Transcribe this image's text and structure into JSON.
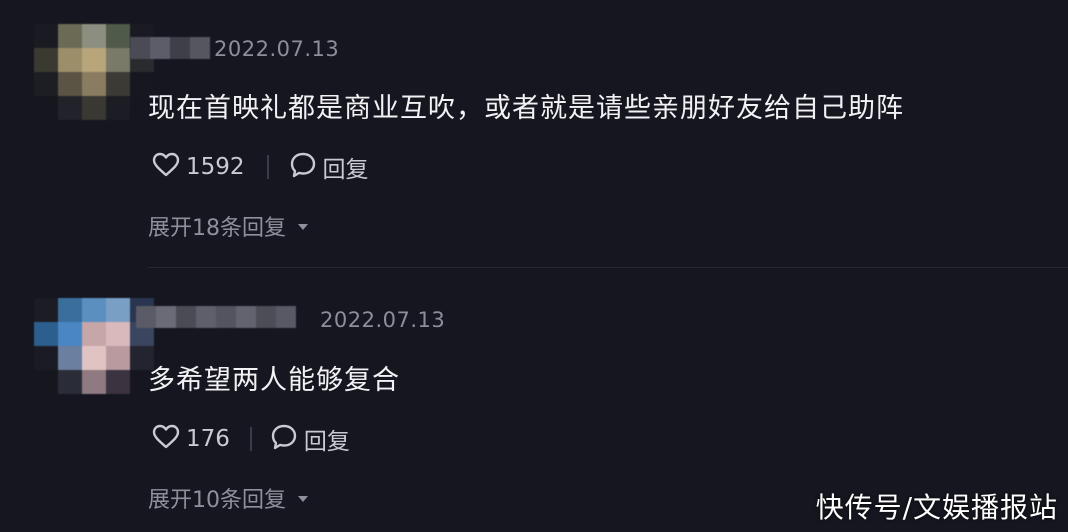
{
  "comments": [
    {
      "date": "2022.07.13",
      "text": "现在首映礼都是商业互吹，或者就是请些亲朋好友给自己助阵",
      "likes": "1592",
      "reply_label": "回复",
      "expand_label": "展开18条回复"
    },
    {
      "date": "2022.07.13",
      "text": "多希望两人能够复合",
      "likes": "176",
      "reply_label": "回复",
      "expand_label": "展开10条回复"
    }
  ],
  "watermark": "快传号/文娱播报站",
  "colors": {
    "background": "#15161f",
    "text_primary": "#f2f2f5",
    "text_secondary": "#8d8e99",
    "action_text": "#c9cad2"
  },
  "icons": [
    "heart-icon",
    "comment-bubble-icon",
    "chevron-down-icon"
  ]
}
